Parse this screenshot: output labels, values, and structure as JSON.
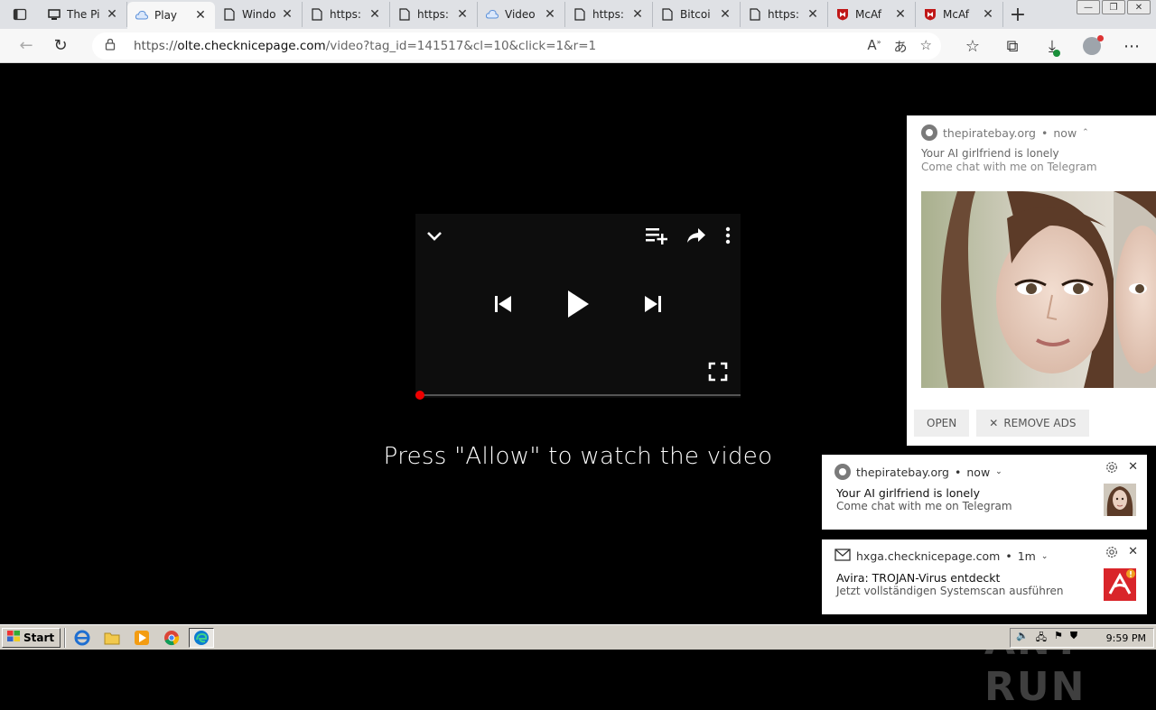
{
  "browser": {
    "tabs": [
      {
        "label": "The Pi",
        "icon": "monitor-icon",
        "active": false
      },
      {
        "label": "Play",
        "icon": "cloud-icon",
        "active": true
      },
      {
        "label": "Windo",
        "icon": "page-icon",
        "active": false
      },
      {
        "label": "https:",
        "icon": "page-icon",
        "active": false
      },
      {
        "label": "https:",
        "icon": "page-icon",
        "active": false
      },
      {
        "label": "Video",
        "icon": "cloud-icon",
        "active": false
      },
      {
        "label": "https:",
        "icon": "page-icon",
        "active": false
      },
      {
        "label": "Bitcoi",
        "icon": "page-icon",
        "active": false
      },
      {
        "label": "https:",
        "icon": "page-icon",
        "active": false
      },
      {
        "label": "McAf",
        "icon": "mcafee-icon",
        "active": false
      },
      {
        "label": "McAf",
        "icon": "mcafee-icon",
        "active": false
      }
    ],
    "address": {
      "scheme": "https://",
      "host": "olte.checknicepage.com",
      "path": "/video?tag_id=141517&cl=10&click=1&r=1"
    }
  },
  "player": {
    "progress": 0,
    "message": "Press \"Allow\" to watch the video"
  },
  "big_notification": {
    "site": "thepiratebay.org",
    "time": "now",
    "title": "Your AI girlfriend is lonely",
    "body": "Come chat with me on Telegram",
    "open_label": "OPEN",
    "remove_label": "REMOVE ADS"
  },
  "notifications": [
    {
      "site": "thepiratebay.org",
      "time": "now",
      "title": "Your AI girlfriend is lonely",
      "body": "Come chat with me on Telegram"
    },
    {
      "site": "hxga.checknicepage.com",
      "time": "1m",
      "title": "Avira: TROJAN-Virus entdeckt",
      "body": "Jetzt vollständigen Systemscan ausführen"
    }
  ],
  "watermark": "ANY RUN",
  "taskbar": {
    "start_label": "Start",
    "clock": "9:59 PM"
  },
  "colors": {
    "progress": "#ee0000",
    "avira_red": "#d9252a",
    "mcafee_red": "#c01818"
  }
}
